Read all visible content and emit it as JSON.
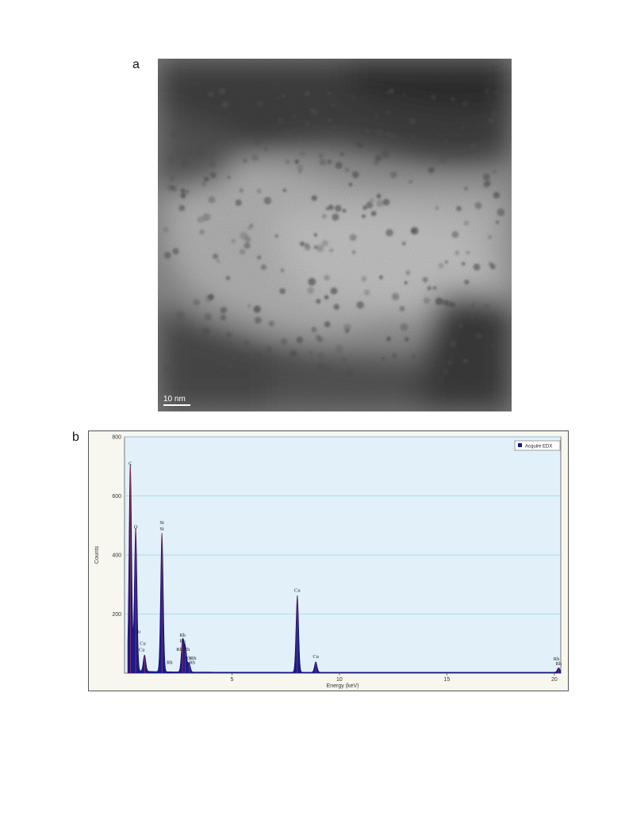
{
  "figure": {
    "panel_a_label": "a",
    "panel_b_label": "b",
    "scale_bar_text": "10 nm"
  },
  "chart_data": {
    "type": "line",
    "title": "",
    "xlabel": "Energy (keV)",
    "ylabel": "Counts",
    "xlim": [
      0,
      20.3
    ],
    "ylim": [
      0,
      800
    ],
    "xticks": [
      5,
      10,
      15,
      20
    ],
    "yticks": [
      200,
      400,
      600,
      800
    ],
    "grid": "horizontal",
    "legend_position": "top-right",
    "series": [
      {
        "name": "Acquire EDX",
        "color": "#1a1a8c",
        "peaks": [
          {
            "x": 0.27,
            "y": 700
          },
          {
            "x": 0.52,
            "y": 485
          },
          {
            "x": 0.93,
            "y": 55
          },
          {
            "x": 1.74,
            "y": 470
          },
          {
            "x": 2.7,
            "y": 105
          },
          {
            "x": 2.83,
            "y": 80
          },
          {
            "x": 3.0,
            "y": 30
          },
          {
            "x": 8.04,
            "y": 260
          },
          {
            "x": 8.9,
            "y": 35
          },
          {
            "x": 20.2,
            "y": 15
          }
        ]
      }
    ],
    "annotations": [
      {
        "text": "C",
        "x": 0.27,
        "y": 700
      },
      {
        "text": "O",
        "x": 0.52,
        "y": 485
      },
      {
        "text": "Cu",
        "x": 0.6,
        "y": 130
      },
      {
        "text": "Cu",
        "x": 0.85,
        "y": 90
      },
      {
        "text": "Cu",
        "x": 0.8,
        "y": 68
      },
      {
        "text": "Si",
        "x": 1.74,
        "y": 500
      },
      {
        "text": "Si",
        "x": 1.74,
        "y": 478
      },
      {
        "text": "Rh",
        "x": 2.1,
        "y": 25
      },
      {
        "text": "Rh",
        "x": 2.7,
        "y": 118
      },
      {
        "text": "Rh",
        "x": 2.7,
        "y": 98
      },
      {
        "text": "Rh",
        "x": 2.55,
        "y": 70
      },
      {
        "text": "Rh",
        "x": 2.9,
        "y": 70
      },
      {
        "text": "Rh",
        "x": 2.95,
        "y": 40
      },
      {
        "text": "Rh",
        "x": 3.2,
        "y": 40
      },
      {
        "text": "Rh",
        "x": 3.15,
        "y": 25
      },
      {
        "text": "Cu",
        "x": 8.04,
        "y": 270
      },
      {
        "text": "Cu",
        "x": 8.9,
        "y": 45
      },
      {
        "text": "Rh",
        "x": 20.1,
        "y": 38
      },
      {
        "text": "Rh",
        "x": 20.2,
        "y": 22
      }
    ]
  }
}
